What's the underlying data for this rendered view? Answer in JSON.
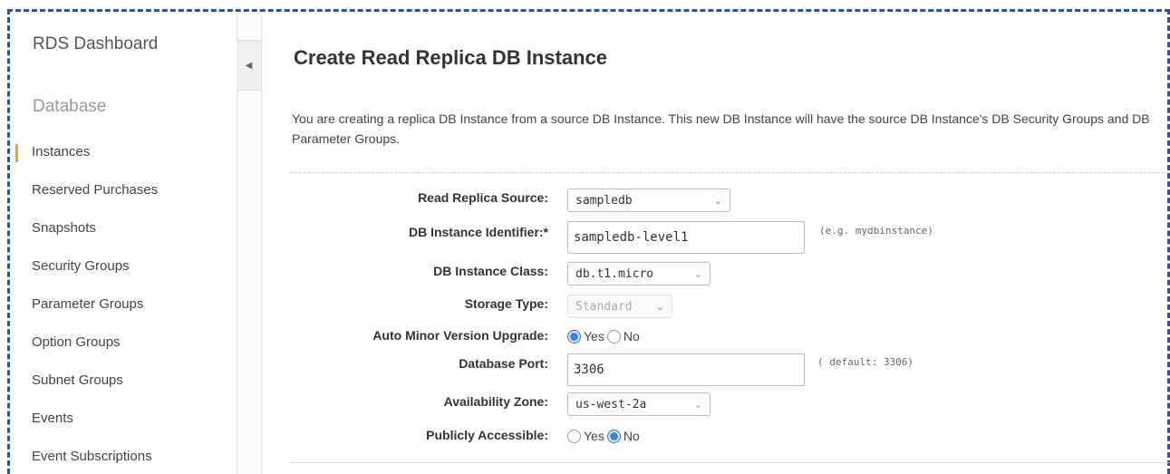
{
  "sidebar": {
    "title": "RDS Dashboard",
    "section": "Database",
    "items": [
      {
        "label": "Instances",
        "active": true
      },
      {
        "label": "Reserved Purchases"
      },
      {
        "label": "Snapshots"
      },
      {
        "label": "Security Groups"
      },
      {
        "label": "Parameter Groups"
      },
      {
        "label": "Option Groups"
      },
      {
        "label": "Subnet Groups"
      },
      {
        "label": "Events"
      },
      {
        "label": "Event Subscriptions"
      }
    ]
  },
  "collapse_icon": "caret-left-icon",
  "main": {
    "title": "Create Read Replica DB Instance",
    "description": "You are creating a replica DB Instance from a source DB Instance. This new DB Instance will have the source DB Instance's DB Security Groups and DB Parameter Groups."
  },
  "form": {
    "read_replica_source": {
      "label": "Read Replica Source:",
      "value": "sampledb"
    },
    "db_instance_identifier": {
      "label": "DB Instance Identifier:*",
      "value": "sampledb-level1",
      "hint": "(e.g. mydbinstance)"
    },
    "db_instance_class": {
      "label": "DB Instance Class:",
      "value": "db.t1.micro"
    },
    "storage_type": {
      "label": "Storage Type:",
      "value": "Standard"
    },
    "auto_minor_version_upgrade": {
      "label": "Auto Minor Version Upgrade:",
      "yes": "Yes",
      "no": "No",
      "selected": "Yes"
    },
    "database_port": {
      "label": "Database Port:",
      "value": "3306",
      "hint": "( default: 3306)"
    },
    "availability_zone": {
      "label": "Availability Zone:",
      "value": "us-west-2a"
    },
    "publicly_accessible": {
      "label": "Publicly Accessible:",
      "yes": "Yes",
      "no": "No",
      "selected": "No"
    }
  },
  "colors": {
    "frame": "#2f5590",
    "active_marker": "#e8a43a",
    "radio_selected": "#3b82d6"
  }
}
